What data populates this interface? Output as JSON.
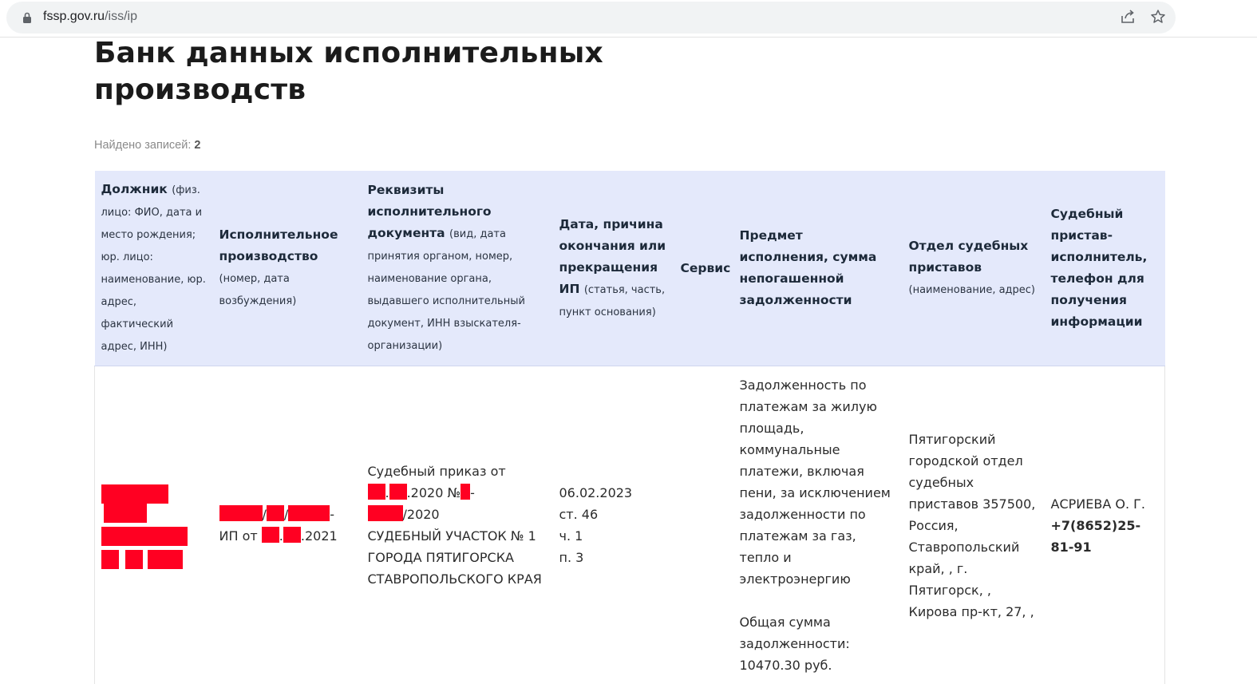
{
  "browser": {
    "url_domain": "fssp.gov.ru",
    "url_path": "/iss/ip",
    "share_icon": "share-icon",
    "bookmark_icon": "star-icon"
  },
  "page": {
    "title": "Банк данных исполнительных производств",
    "found_label": "Найдено записей:",
    "found_count": "2"
  },
  "table": {
    "headers": [
      {
        "title": "Должник",
        "sub": "(физ. лицо: ФИО, дата и место рождения; юр. лицо: наименование, юр. адрес, фактический адрес, ИНН)"
      },
      {
        "title": "Исполнительное производство",
        "sub": "(номер, дата возбуждения)"
      },
      {
        "title": "Реквизиты исполнительного документа",
        "sub": "(вид, дата принятия органом, номер, наименование органа, выдавшего исполнительный документ, ИНН взыскателя-организации)"
      },
      {
        "title": "Дата, причина окончания или прекращения ИП",
        "sub": "(статья, часть, пункт основания)"
      },
      {
        "title": "Сервис",
        "sub": ""
      },
      {
        "title": "Предмет исполнения, сумма непогашенной задолженности",
        "sub": ""
      },
      {
        "title": "Отдел судебных приставов",
        "sub": "(наименование, адрес)"
      },
      {
        "title": "Судебный пристав-исполнитель, телефон для получения информации",
        "sub": ""
      }
    ],
    "row": {
      "ip_suffix": "-",
      "ip_date_prefix": "ИП от",
      "ip_date_year": ".2021",
      "doc_prefix": "Судебный приказ от",
      "doc_date_year": ".2020 №",
      "doc_dash": "-",
      "doc_year": "/2020",
      "doc_court": "СУДЕБНЫЙ УЧАСТОК № 1 ГОРОДА ПЯТИГОРСКА СТАВРОПОЛЬСКОГО КРАЯ",
      "end_date": "06.02.2023",
      "end_article": "ст. 46",
      "end_part": "ч. 1",
      "end_point": "п. 3",
      "subject": "Задолженность по платежам за жилую площадь, коммунальные платежи, включая пени, за исключением задолженности по платежам за газ, тепло и электроэнергию",
      "total_label": "Общая сумма задолженности:",
      "total_value": "10470.30 руб.",
      "department": "Пятигорский городской отдел судебных приставов 357500, Россия, Ставропольский край, , г. Пятигорск, , Кирова пр-кт, 27, ,",
      "bailiff": "АСРИЕВА О. Г.",
      "phone": "+7(8652)25-81-91"
    }
  },
  "colors": {
    "header_bg": "#e4e9fb",
    "redaction": "#ff0022"
  }
}
